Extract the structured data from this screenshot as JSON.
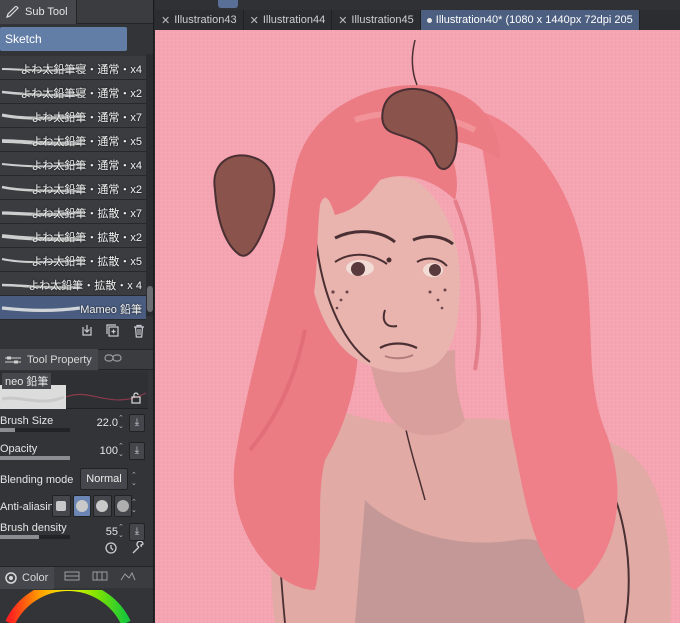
{
  "subtool": {
    "tab_label": "Sub Tool",
    "group_label": "Sketch",
    "brushes": [
      {
        "name": "よわ太鉛筆寝・通常・x4"
      },
      {
        "name": "よわ太鉛筆寝・通常・x2"
      },
      {
        "name": "よわ太鉛筆・通常・x7"
      },
      {
        "name": "よわ太鉛筆・通常・x5"
      },
      {
        "name": "よわ太鉛筆・通常・x4"
      },
      {
        "name": "よわ太鉛筆・通常・x2"
      },
      {
        "name": "よわ太鉛筆・拡散・x7"
      },
      {
        "name": "よわ太鉛筆・拡散・x2"
      },
      {
        "name": "よわ太鉛筆・拡散・x5"
      },
      {
        "name": "よわ太鉛筆・拡散・x 4"
      },
      {
        "name": "Mameo 鉛筆"
      }
    ],
    "selected_index": 10
  },
  "tool_property": {
    "tab_label": "Tool Property",
    "preview_name": "neo 鉛筆",
    "brush_size": {
      "label": "Brush Size",
      "value": "22.0",
      "fill": 0.22
    },
    "opacity": {
      "label": "Opacity",
      "value": "100",
      "fill": 1.0
    },
    "blending_mode": {
      "label": "Blending mode",
      "value": "Normal"
    },
    "anti_aliasing": {
      "label": "Anti-aliasing",
      "selected": 1
    },
    "brush_density": {
      "label": "Brush density",
      "value": "55",
      "fill": 0.55
    }
  },
  "color_panel": {
    "tab_label": "Color"
  },
  "document_tabs": [
    {
      "label": "Illustration43",
      "active": false
    },
    {
      "label": "Illustration44",
      "active": false
    },
    {
      "label": "Illustration45",
      "active": false
    },
    {
      "label": "Illustration40* (1080 x 1440px 72dpi 205",
      "active": true
    }
  ],
  "colors": {
    "canvas_bg": "#f5a5b1",
    "selection_blue": "#627ea7",
    "hair": "#ec7c84",
    "skin": "#e9b3ae",
    "ears": "#8a534c",
    "line": "#4a2f33"
  }
}
